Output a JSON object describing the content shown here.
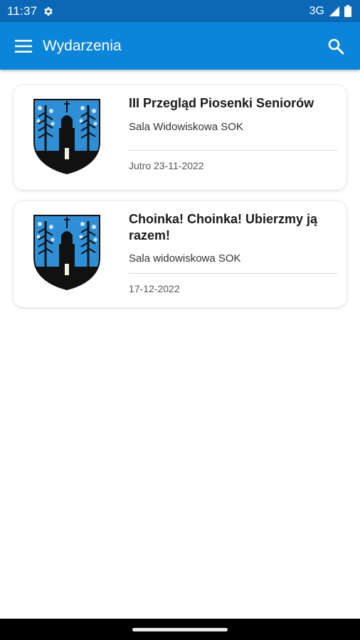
{
  "status_bar": {
    "time": "11:37",
    "network": "3G",
    "gear_icon": "gear-icon",
    "signal_icon": "signal-icon",
    "battery_icon": "battery-icon"
  },
  "app_bar": {
    "title": "Wydarzenia",
    "menu_icon": "menu-icon",
    "search_icon": "search-icon",
    "color": "#0a85d9"
  },
  "events": [
    {
      "title": "III Przegląd Piosenki Seniorów",
      "venue": "Sala Widowiskowa SOK",
      "date": "Jutro 23-11-2022",
      "image": "coat-of-arms"
    },
    {
      "title": "Choinka! Choinka! Ubierzmy ją razem!",
      "venue": "Sala widowiskowa SOK",
      "date": "17-12-2022",
      "image": "coat-of-arms"
    }
  ],
  "colors": {
    "status_bar": "#0a68b6",
    "crest_blue": "#2f8fd6",
    "crest_black": "#111111"
  }
}
